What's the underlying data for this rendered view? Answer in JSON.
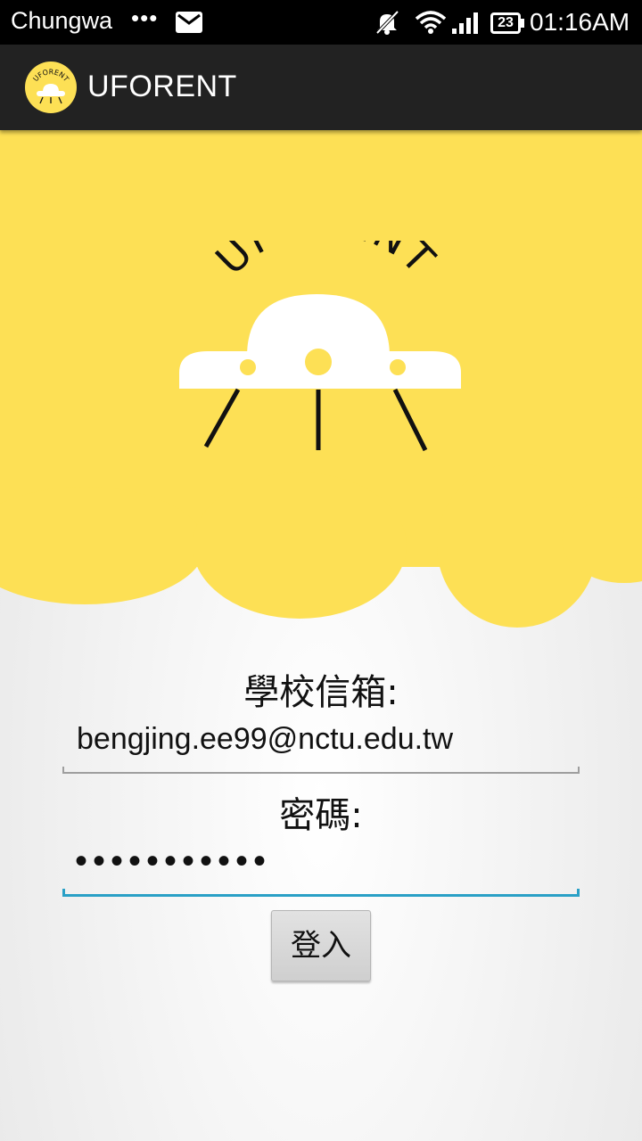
{
  "status_bar": {
    "carrier": "Chungwa",
    "overflow_dots": "•••",
    "icons": [
      "mail-icon",
      "bell-muted-icon",
      "wifi-icon",
      "signal-icon",
      "battery-icon"
    ],
    "battery_level": "23",
    "time": "01:16AM"
  },
  "app_bar": {
    "title": "UFORENT",
    "icon_text": "UFORENT"
  },
  "header": {
    "logo_text": "UFORENT",
    "background_color": "#fde055"
  },
  "form": {
    "email_label": "學校信箱:",
    "email_value": "bengjing.ee99@nctu.edu.tw",
    "password_label": "密碼:",
    "password_value": "•••••••••••",
    "login_label": "登入",
    "focus_color": "#2aa0c6"
  }
}
